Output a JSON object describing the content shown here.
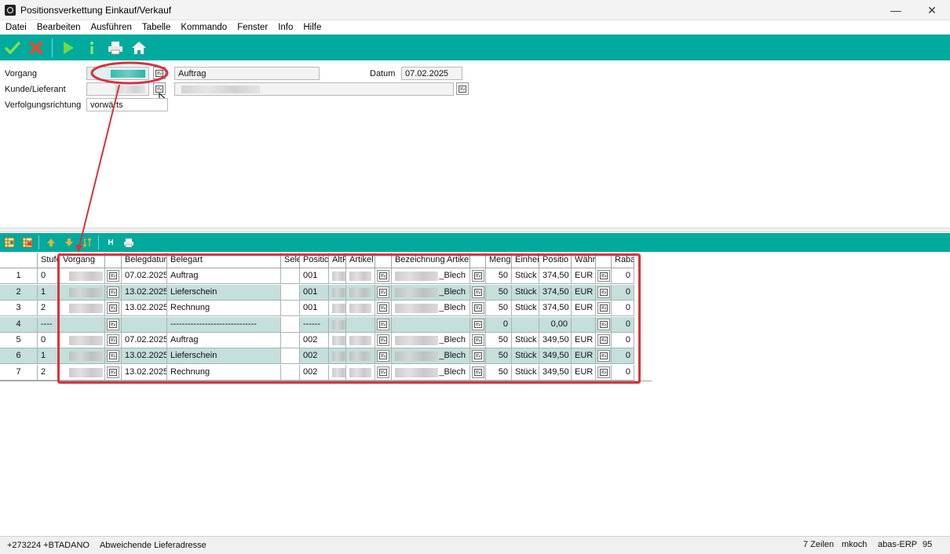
{
  "window": {
    "title": "Positionsverkettung Einkauf/Verkauf",
    "minimize": "—",
    "close": "✕"
  },
  "menu": [
    "Datei",
    "Bearbeiten",
    "Ausführen",
    "Tabelle",
    "Kommando",
    "Fenster",
    "Info",
    "Hilfe"
  ],
  "toolbar": {
    "icons": [
      "check-icon",
      "cancel-icon",
      "run-icon",
      "info-icon",
      "print-icon",
      "home-icon"
    ]
  },
  "form": {
    "vorgang_label": "Vorgang",
    "vorgang_type": "Auftrag",
    "datum_label": "Datum",
    "datum_value": "07.02.2025",
    "kunde_label": "Kunde/Lieferant",
    "richtung_label": "Verfolgungsrichtung",
    "richtung_value": "vorwärts"
  },
  "table_toolbar": {
    "h_label": "H"
  },
  "table": {
    "headers": [
      "",
      "Stufe",
      "Vorgang",
      "",
      "Belegdatum",
      "Belegart",
      "Sele",
      "Positic",
      "AltF",
      "Artikel",
      "",
      "Bezeichnung Artikel",
      "",
      "Meng",
      "Einhei",
      "Positio",
      "Währ",
      "",
      "Raba"
    ],
    "rows": [
      {
        "n": "1",
        "stufe": "0",
        "datum": "07.02.2025",
        "belegart": "Auftrag",
        "pos": "001",
        "bez": "_Blech",
        "menge": "50",
        "einheit": "Stück",
        "preis": "374,50",
        "waehr": "EUR",
        "rabatt": "0"
      },
      {
        "n": "2",
        "stufe": "1",
        "datum": "13.02.2025",
        "belegart": "Lieferschein",
        "pos": "001",
        "bez": "_Blech",
        "menge": "50",
        "einheit": "Stück",
        "preis": "374,50",
        "waehr": "EUR",
        "rabatt": "0"
      },
      {
        "n": "3",
        "stufe": "2",
        "datum": "13.02.2025",
        "belegart": "Rechnung",
        "pos": "001",
        "bez": "_Blech",
        "menge": "50",
        "einheit": "Stück",
        "preis": "374,50",
        "waehr": "EUR",
        "rabatt": "0"
      },
      {
        "n": "4",
        "stufe": "----",
        "datum": "",
        "belegart": "------------------------------",
        "pos": "------",
        "bez": "",
        "menge": "0",
        "einheit": "",
        "preis": "0,00",
        "waehr": "",
        "rabatt": "0"
      },
      {
        "n": "5",
        "stufe": "0",
        "datum": "07.02.2025",
        "belegart": "Auftrag",
        "pos": "002",
        "bez": "_Blech",
        "menge": "50",
        "einheit": "Stück",
        "preis": "349,50",
        "waehr": "EUR",
        "rabatt": "0"
      },
      {
        "n": "6",
        "stufe": "1",
        "datum": "13.02.2025",
        "belegart": "Lieferschein",
        "pos": "002",
        "bez": "_Blech",
        "menge": "50",
        "einheit": "Stück",
        "preis": "349,50",
        "waehr": "EUR",
        "rabatt": "0"
      },
      {
        "n": "7",
        "stufe": "2",
        "datum": "13.02.2025",
        "belegart": "Rechnung",
        "pos": "002",
        "bez": "_Blech",
        "menge": "50",
        "einheit": "Stück",
        "preis": "349,50",
        "waehr": "EUR",
        "rabatt": "0"
      }
    ]
  },
  "status": {
    "code": "+273224 +BTADANO",
    "message": "Abweichende Lieferadresse",
    "rows": "7 Zeilen",
    "user": "mkoch",
    "app": "abas-ERP",
    "number": "95"
  },
  "colors": {
    "accent": "#00aa9d",
    "row_alt": "#c4dfdc",
    "annotation": "#d8333f"
  }
}
